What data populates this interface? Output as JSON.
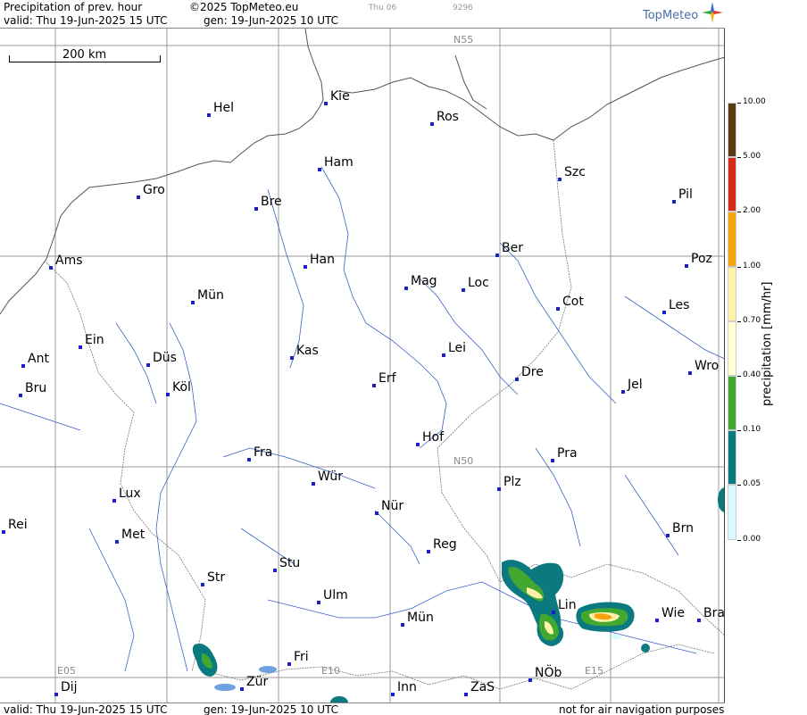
{
  "header": {
    "title": "Precipitation of prev. hour",
    "copyright": "©2025 TopMeteo.eu",
    "run_code": "Thu 06",
    "id_code": "9296",
    "valid": "valid:  Thu  19-Jun-2025  15 UTC",
    "gen": "gen: 19-Jun-2025 10 UTC",
    "logo": "TopMeteo"
  },
  "footer": {
    "valid": "valid:  Thu  19-Jun-2025  15 UTC",
    "gen": "gen: 19-Jun-2025 10 UTC",
    "note": "not for air navigation purposes"
  },
  "scale_bar": {
    "label": "200 km"
  },
  "grid_labels": {
    "n55": "N55",
    "n50": "N50",
    "e05": "E05",
    "e10": "E10",
    "e15": "E15"
  },
  "cities": [
    {
      "name": "Hel"
    },
    {
      "name": "Kie"
    },
    {
      "name": "Ros"
    },
    {
      "name": "Ham"
    },
    {
      "name": "Szc"
    },
    {
      "name": "Gro"
    },
    {
      "name": "Bre"
    },
    {
      "name": "Pil"
    },
    {
      "name": "Ber"
    },
    {
      "name": "Ams"
    },
    {
      "name": "Han"
    },
    {
      "name": "Poz"
    },
    {
      "name": "Mag"
    },
    {
      "name": "Loc"
    },
    {
      "name": "Mün"
    },
    {
      "name": "Cot"
    },
    {
      "name": "Les"
    },
    {
      "name": "Ein"
    },
    {
      "name": "Kas"
    },
    {
      "name": "Lei"
    },
    {
      "name": "Ant"
    },
    {
      "name": "Düs"
    },
    {
      "name": "Wro"
    },
    {
      "name": "Erf"
    },
    {
      "name": "Dre"
    },
    {
      "name": "Bru"
    },
    {
      "name": "Köl"
    },
    {
      "name": "Jel"
    },
    {
      "name": "Hof"
    },
    {
      "name": "Fra"
    },
    {
      "name": "Pra"
    },
    {
      "name": "Wür"
    },
    {
      "name": "Lux"
    },
    {
      "name": "Plz"
    },
    {
      "name": "Nür"
    },
    {
      "name": "Rei"
    },
    {
      "name": "Brn"
    },
    {
      "name": "Met"
    },
    {
      "name": "Reg"
    },
    {
      "name": "Stu"
    },
    {
      "name": "Str"
    },
    {
      "name": "Ulm"
    },
    {
      "name": "Lin"
    },
    {
      "name": "Wie"
    },
    {
      "name": "Bra"
    },
    {
      "name": "Mün"
    },
    {
      "name": "Fri"
    },
    {
      "name": "NÖb"
    },
    {
      "name": "Dij"
    },
    {
      "name": "Zür"
    },
    {
      "name": "Inn"
    },
    {
      "name": "ZaS"
    }
  ],
  "legend": {
    "title": "precipitation  [mm/hr]",
    "levels": [
      {
        "label": "10.00",
        "color": "#5a3a14"
      },
      {
        "label": "5.00",
        "color": "#d42a1e"
      },
      {
        "label": "2.00",
        "color": "#f5a30f"
      },
      {
        "label": "1.00",
        "color": "#fff2a8"
      },
      {
        "label": "0.70",
        "color": "#ffffd2"
      },
      {
        "label": "0.40",
        "color": "#42a82f"
      },
      {
        "label": "0.10",
        "color": "#0b7a80"
      },
      {
        "label": "0.05",
        "color": "#d8fbff"
      },
      {
        "label": "0.00",
        "color": "#ffffff"
      }
    ]
  }
}
